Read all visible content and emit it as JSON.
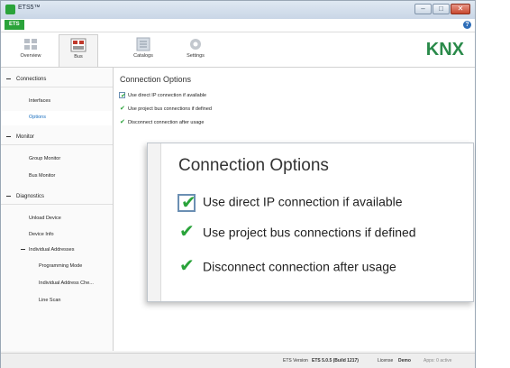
{
  "window": {
    "title": "ETS5™",
    "app_tab": "ETS",
    "help": "?"
  },
  "ribbon": {
    "overview": "Overview",
    "bus": "Bus",
    "catalogs": "Catalogs",
    "settings": "Settings",
    "brand": "KNX"
  },
  "sidebar": {
    "connections": "Connections",
    "interfaces": "Interfaces",
    "options": "Options",
    "monitor": "Monitor",
    "group_monitor": "Group Monitor",
    "bus_monitor": "Bus Monitor",
    "diagnostics": "Diagnostics",
    "unload_device": "Unload Device",
    "device_info": "Device Info",
    "individual_addresses": "Individual Addresses",
    "programming_mode": "Programming Mode",
    "individual_address_check": "Individual Address Che...",
    "line_scan": "Line Scan"
  },
  "content": {
    "title": "Connection Options",
    "options": [
      {
        "label": "Use direct IP connection if available",
        "checked": true
      },
      {
        "label": "Use project bus connections if defined",
        "checked": true
      },
      {
        "label": "Disconnect connection after usage",
        "checked": true
      }
    ]
  },
  "status": {
    "version_label": "ETS Version",
    "version_value": "ETS 5.0.5 (Build 1217)",
    "license_label": "License",
    "license_value": "Demo",
    "apps": "Apps: 0 active"
  },
  "colors": {
    "accent_green": "#2aa33a",
    "selection_blue": "#1a6fbf"
  }
}
